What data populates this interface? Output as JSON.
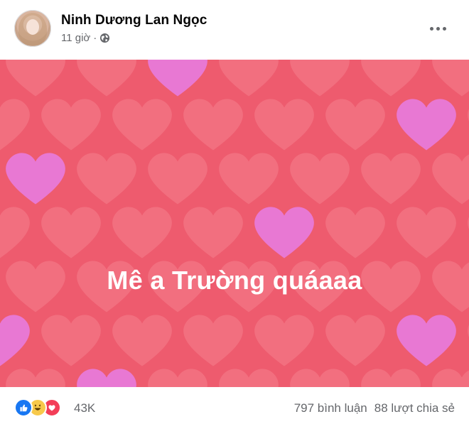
{
  "post": {
    "author": "Ninh Dương Lan Ngọc",
    "time": "11 giờ",
    "separator": "·",
    "privacy_icon": "globe-icon",
    "menu_icon": "more-options-icon"
  },
  "content": {
    "text": "Mê a Trường quáaaa",
    "background": "hearts-pattern",
    "colors": {
      "background": "#ee5b6e",
      "heart_red": "#f27382",
      "heart_pink": "#e77ad8"
    }
  },
  "footer": {
    "reactions": [
      "like-icon",
      "haha-icon",
      "love-icon"
    ],
    "reaction_count": "43K",
    "comments": "797 bình luận",
    "shares": "88 lượt chia sẻ"
  }
}
